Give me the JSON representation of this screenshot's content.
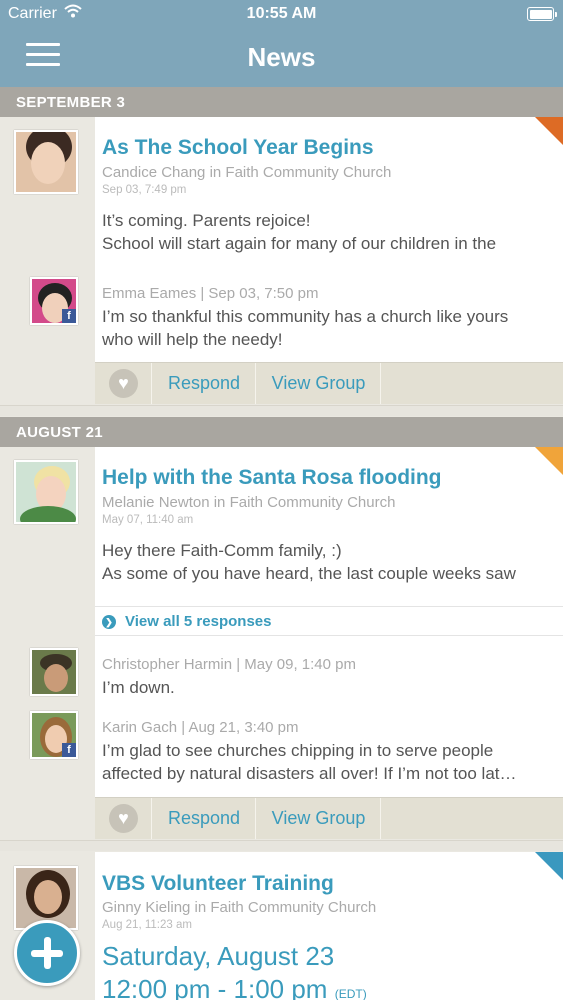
{
  "status_bar": {
    "carrier": "Carrier",
    "time": "10:55 AM"
  },
  "nav": {
    "title": "News"
  },
  "sections": [
    {
      "date": "SEPTEMBER 3"
    },
    {
      "date": "AUGUST 21"
    }
  ],
  "posts": [
    {
      "title": "As The School Year Begins",
      "byline": "Candice Chang in Faith Community Church",
      "timestamp": "Sep 03, 7:49 pm",
      "body": [
        "It’s coming. Parents rejoice!",
        "School will start again for many of our children in the"
      ],
      "responses": [
        {
          "meta": "Emma Eames | Sep 03, 7:50 pm",
          "text": [
            "I’m so thankful this community has a church like yours",
            "who will help the needy!"
          ]
        }
      ],
      "actions": {
        "respond": "Respond",
        "view_group": "View Group"
      }
    },
    {
      "title": "Help with the Santa Rosa flooding",
      "byline": "Melanie Newton in Faith Community Church",
      "timestamp": "May 07, 11:40 am",
      "body": [
        "Hey there Faith-Comm family, :)",
        "As some of you have heard, the last couple weeks saw"
      ],
      "view_all": "View all 5 responses",
      "responses": [
        {
          "meta": "Christopher Harmin | May 09, 1:40 pm",
          "text": [
            "I’m down."
          ]
        },
        {
          "meta": "Karin Gach | Aug 21, 3:40 pm",
          "text": [
            "I’m glad to see churches chipping in to serve people",
            "affected by natural disasters all over! If I’m not too lat…"
          ]
        }
      ],
      "actions": {
        "respond": "Respond",
        "view_group": "View Group"
      }
    },
    {
      "title": "VBS Volunteer Training",
      "byline": "Ginny Kieling in Faith Community Church",
      "timestamp": "Aug 21, 11:23 am",
      "event_date": "Saturday, August 23",
      "event_time": "12:00 pm - 1:00 pm",
      "event_tz": "(EDT)"
    }
  ],
  "icons": {
    "menu": "hamburger-icon",
    "heart": "heart-icon",
    "add": "plus-icon",
    "facebook": "facebook-icon",
    "chevron": "chevron-down-icon"
  },
  "colors": {
    "nav_bg": "#7fa6ba",
    "accent": "#3a9bbc",
    "date_header": "#a9a6a0"
  }
}
